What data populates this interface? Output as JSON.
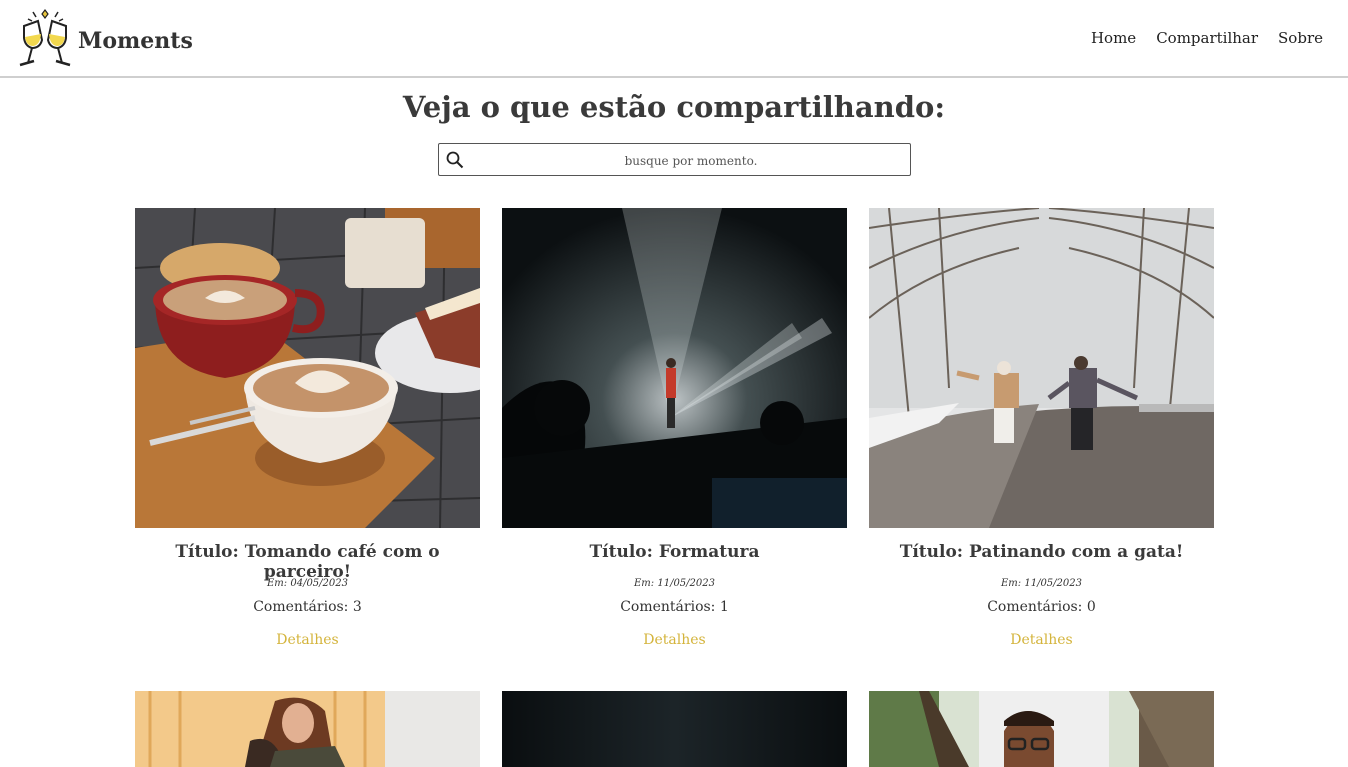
{
  "brand": {
    "name": "Moments",
    "logo_icon": "champagne-toast-icon"
  },
  "nav": {
    "items": [
      "Home",
      "Compartilhar",
      "Sobre"
    ]
  },
  "page_title": "Veja o que estão compartilhando:",
  "search": {
    "placeholder": "busque por momento.",
    "value": "",
    "icon": "search-icon"
  },
  "colors": {
    "accent": "#d4b43c",
    "text": "#333333",
    "divider": "#cfcfcf"
  },
  "cards": [
    {
      "title_prefix": "Título:",
      "title": "Tomando café com o parceiro!",
      "date_prefix": "Em:",
      "date": "04/05/2023",
      "comments_label": "Comentários:",
      "comments": "3",
      "link": "Detalhes",
      "image": "coffee-cups-photo"
    },
    {
      "title_prefix": "Título:",
      "title": "Formatura",
      "date_prefix": "Em:",
      "date": "11/05/2023",
      "comments_label": "Comentários:",
      "comments": "1",
      "link": "Detalhes",
      "image": "concert-stage-photo"
    },
    {
      "title_prefix": "Título:",
      "title": "Patinando com a gata!",
      "date_prefix": "Em:",
      "date": "11/05/2023",
      "comments_label": "Comentários:",
      "comments": "0",
      "link": "Detalhes",
      "image": "snowy-road-couple-photo"
    },
    {
      "image": "hugging-women-photo"
    },
    {
      "image": "dark-stage-photo"
    },
    {
      "image": "man-glasses-palms-photo"
    }
  ]
}
